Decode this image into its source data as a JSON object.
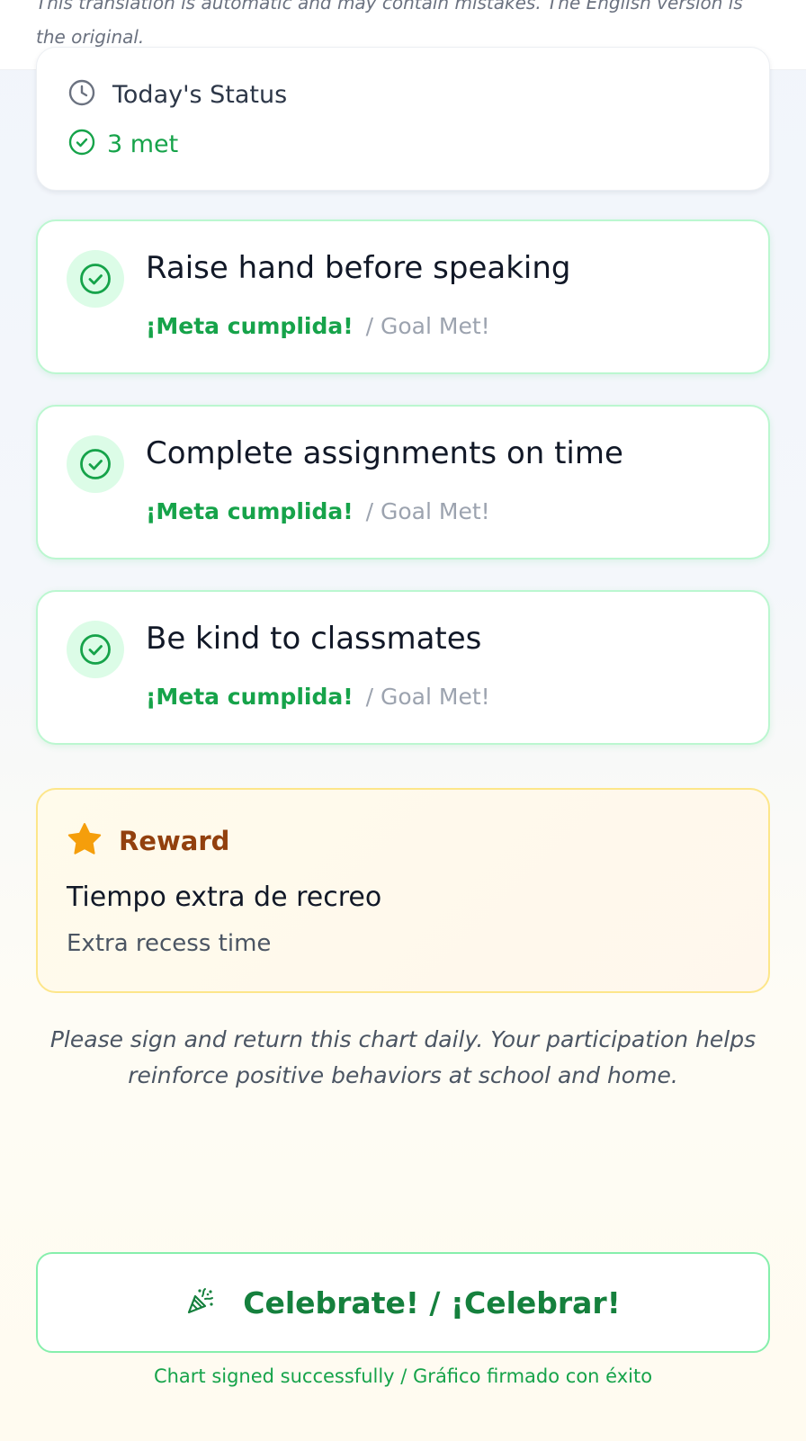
{
  "notice": {
    "text": "This translation is automatic and may contain mistakes. The English version is the original."
  },
  "status": {
    "title": "Today's Status",
    "met": "3 met"
  },
  "goals": [
    {
      "title": "Raise hand before speaking",
      "status_es": "¡Meta cumplida!",
      "status_en": "/ Goal Met!"
    },
    {
      "title": "Complete assignments on time",
      "status_es": "¡Meta cumplida!",
      "status_en": "/ Goal Met!"
    },
    {
      "title": "Be kind to classmates",
      "status_es": "¡Meta cumplida!",
      "status_en": "/ Goal Met!"
    }
  ],
  "reward": {
    "label": "Reward",
    "title_es": "Tiempo extra de recreo",
    "title_en": "Extra recess time"
  },
  "footer": {
    "note": "Please sign and return this chart daily. Your participation helps reinforce positive behaviors at school and home."
  },
  "celebrate": {
    "label": "Celebrate! / ¡Celebrar!",
    "icon": "party-popper-icon"
  },
  "signed_message": "Chart signed successfully / Gráfico firmado con éxito",
  "colors": {
    "success": "#16a34a",
    "success_dark": "#15803d",
    "reward_accent": "#92400e",
    "star": "#f59e0b"
  }
}
